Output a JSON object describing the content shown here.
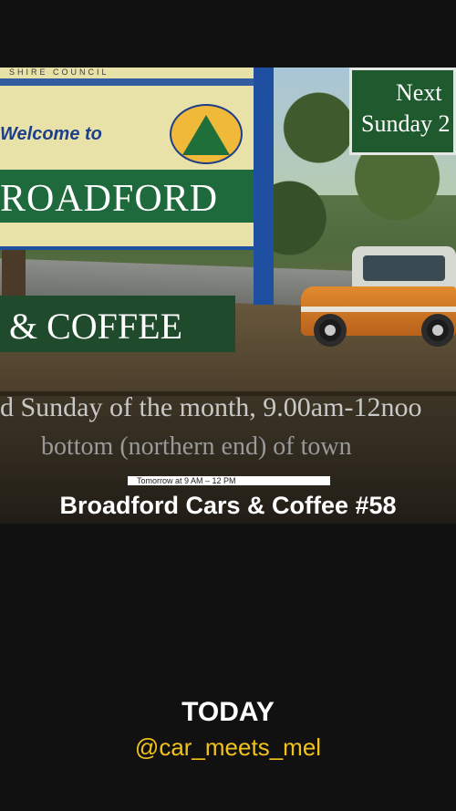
{
  "image": {
    "sign_main": {
      "tag": "SHIRE COUNCIL",
      "welcome": "Welcome to",
      "town": "ROADFORD"
    },
    "sign_next": {
      "line1": "Next",
      "line2": "Sunday 2"
    },
    "coffee_band": "& COFFEE",
    "overlay_line1": "d Sunday of the month, 9.00am-12noo",
    "overlay_line2": "bottom (northern end) of town"
  },
  "event": {
    "time": "Tomorrow at 9 AM – 12 PM",
    "title": "Broadford Cars & Coffee #58"
  },
  "footer": {
    "today": "TODAY",
    "handle": "@car_meets_mel"
  },
  "colors": {
    "background": "#111111",
    "handle": "#f2c21c",
    "sign_green": "#1f6a3c",
    "sign_blue": "#1f4fa0"
  }
}
